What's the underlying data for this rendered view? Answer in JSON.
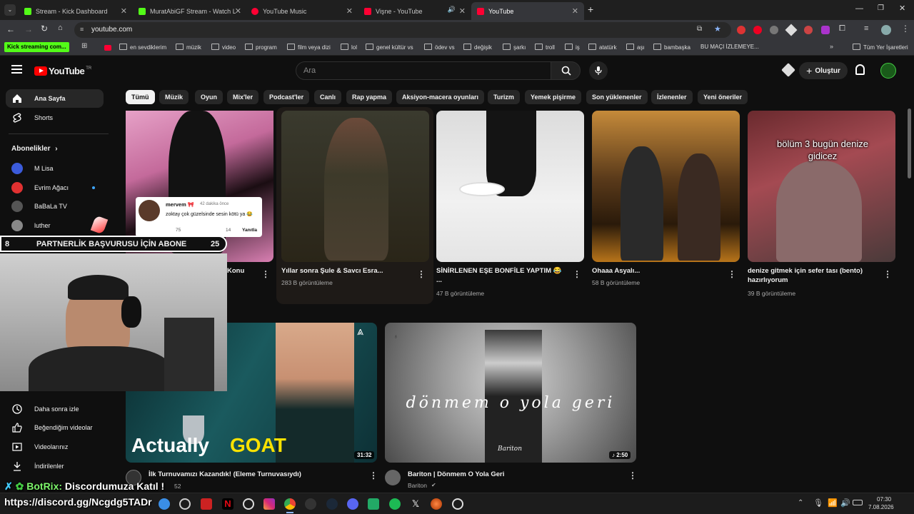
{
  "browser": {
    "tabs": [
      {
        "title": "Stream - Kick Dashboard",
        "color": "#53fc18"
      },
      {
        "title": "MuratAbiGF Stream - Watch Live",
        "color": "#53fc18"
      },
      {
        "title": "YouTube Music",
        "color": "#ff0033"
      },
      {
        "title": "Vişne - YouTube",
        "color": "#ff0033"
      },
      {
        "title": "YouTube",
        "color": "#ff0033"
      }
    ],
    "url": "youtube.com",
    "bookmarks": [
      "Kick streaming com...",
      "en sevdiklerim",
      "müzik",
      "video",
      "program",
      "film veya dizi",
      "lol",
      "genel kültür vs",
      "ödev vs",
      "değişik",
      "şarkı",
      "troll",
      "iş",
      "atatürk",
      "aşı",
      "bambaşka",
      "BU MAÇI İZLEMEYE...",
      "Tüm Yer İşaretleri"
    ]
  },
  "youtube": {
    "logo": "YouTube",
    "logo_sup": "TR",
    "search_placeholder": "Ara",
    "create_label": "Oluştur",
    "chips": [
      "Tümü",
      "Müzik",
      "Oyun",
      "Mix'ler",
      "Podcast'ler",
      "Canlı",
      "Rap yapma",
      "Aksiyon-macera oyunları",
      "Turizm",
      "Yemek pişirme",
      "Son yüklenenler",
      "İzlenenler",
      "Yeni öneriler"
    ],
    "sidebar": {
      "home": "Ana Sayfa",
      "shorts": "Shorts",
      "subs_header": "Abonelikler",
      "channels": [
        "M Lisa",
        "Evrim Ağacı",
        "BaBaLa TV",
        "luther"
      ],
      "library": [
        "Daha sonra izle",
        "Beğendiğim videolar",
        "Videolarınız",
        "İndirilenler"
      ]
    },
    "videos_row1": [
      {
        "title": "Konu",
        "meta": ""
      },
      {
        "title": "Yıllar sonra Şule & Savcı Esra...",
        "meta": "283 B görüntüleme"
      },
      {
        "title": "SİNİRLENEN EŞE BONFİLE YAPTIM 😂 ...",
        "meta": "47 B görüntüleme"
      },
      {
        "title": "Ohaaa Asyalı...",
        "meta": "58 B görüntüleme"
      },
      {
        "title": "denize gitmek için sefer tası (bento) hazırlıyorum",
        "meta": "39 B görüntüleme",
        "overlay": "bölüm 3 bugün denize gidicez"
      }
    ],
    "videos_row2": [
      {
        "title": "İlk Turnuvamızı Kazandık! (Eleme Turnuvasıydı)",
        "meta": "52",
        "duration": "31:32",
        "overlay_a": "Actually",
        "overlay_b": "GOAT"
      },
      {
        "title": "Bariton | Dönmem O Yola Geri",
        "meta": "Bariton",
        "duration": "♪ 2:50",
        "overlay": "dönmem o yola geri",
        "sig": "Bariton"
      }
    ],
    "comment": {
      "user": "mervem 🎀",
      "time": "42 dakika önce",
      "text": "zoktay çok güzelsinde sesin kötü ya 😂",
      "likes": "75",
      "replies": "14",
      "reply_label": "Yanıtla"
    }
  },
  "stream_overlay": {
    "banner_left": "8",
    "banner_text": "PARTNERLİK BAŞVURUSU İÇİN ABONE",
    "banner_right": "25",
    "bot_name": "BotRix:",
    "bot_msg": "Discordumuza Katıl !",
    "discord_link": "https://discord.gg/Ncgdg5TADr"
  },
  "taskbar": {
    "time": "07:30",
    "date": "7.08.2026"
  }
}
